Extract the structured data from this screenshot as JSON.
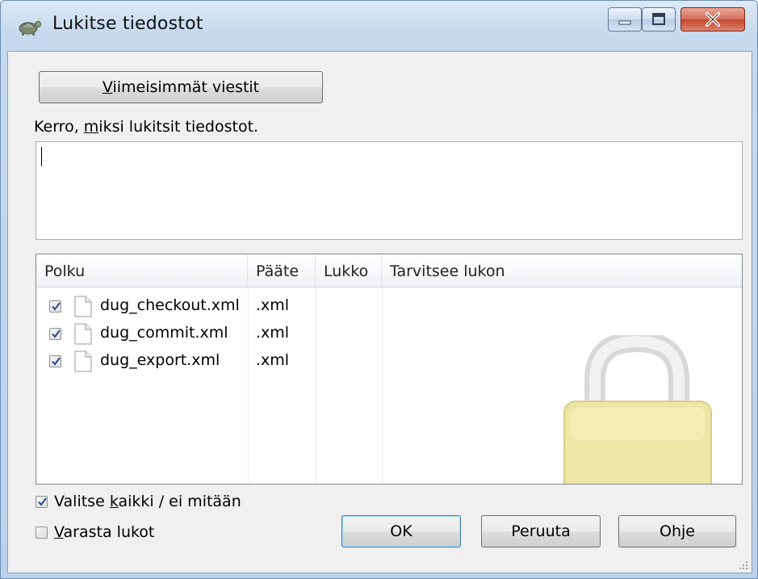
{
  "window": {
    "title": "Lukitse tiedostot",
    "icon": "tortoise-icon",
    "controls": [
      "minimize-icon",
      "maximize-icon",
      "close-icon"
    ]
  },
  "recent_messages_button": {
    "prefix": "",
    "mnemonic": "V",
    "rest": "iimeisimmät viestit"
  },
  "message_label": {
    "before": "Kerro, ",
    "mnemonic": "m",
    "after": "iksi lukitsit tiedostot."
  },
  "message_input": {
    "value": ""
  },
  "file_list": {
    "columns": [
      "Polku",
      "Pääte",
      "Lukko",
      "Tarvitsee lukon"
    ],
    "rows": [
      {
        "checked": true,
        "path": "dug_checkout.xml",
        "ext": ".xml",
        "lock": "",
        "needs_lock": ""
      },
      {
        "checked": true,
        "path": "dug_commit.xml",
        "ext": ".xml",
        "lock": "",
        "needs_lock": ""
      },
      {
        "checked": true,
        "path": "dug_export.xml",
        "ext": ".xml",
        "lock": "",
        "needs_lock": ""
      }
    ],
    "watermark_icon": "padlock-icon"
  },
  "select_all": {
    "checked": true,
    "before": "Valitse ",
    "mnemonic": "k",
    "after": "aikki / ei mitään"
  },
  "steal_locks": {
    "checked": false,
    "before": "",
    "mnemonic": "V",
    "after": "arasta lukot"
  },
  "buttons": {
    "ok": "OK",
    "cancel": "Peruuta",
    "help": "Ohje"
  },
  "colors": {
    "lock_body": "#efe9a8",
    "lock_shackle": "#e6e6e6",
    "ok_border": "#3c7fb1"
  }
}
